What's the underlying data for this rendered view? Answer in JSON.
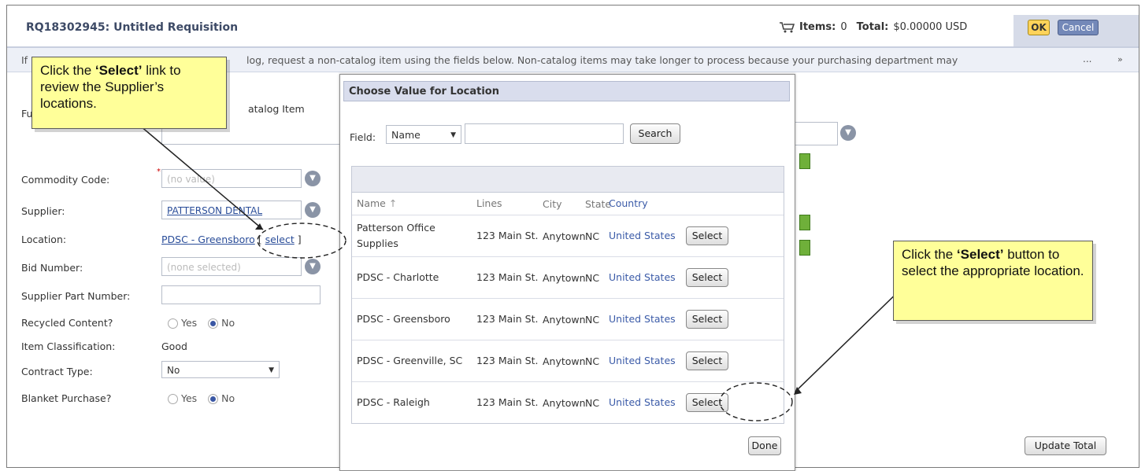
{
  "header": {
    "title": "RQ18302945: Untitled Requisition",
    "items_label": "Items:",
    "items_value": "0",
    "total_label": "Total:",
    "total_value": "$0.00000 USD",
    "ok_label": "OK",
    "cancel_label": "Cancel"
  },
  "info_bar": {
    "lead": "If",
    "text": "log, request a non-catalog item using the fields below. Non-catalog items may take longer to process because your purchasing department may",
    "dots": "...",
    "scroll_icon": "»"
  },
  "form": {
    "partial_label": "Fu",
    "partial_value": "atalog Item",
    "commodity_label": "Commodity Code:",
    "commodity_value": "(no value)",
    "supplier_label": "Supplier:",
    "supplier_value": "PATTERSON DENTAL",
    "location_label": "Location:",
    "location_value": "PDSC - Greensboro",
    "location_select_prefix": "[",
    "location_select": "select",
    "location_select_suffix": "]",
    "bid_label": "Bid Number:",
    "bid_value": "(none selected)",
    "part_label": "Supplier Part Number:",
    "recycled_label": "Recycled Content?",
    "yes": "Yes",
    "no": "No",
    "item_class_label": "Item Classification:",
    "item_class_value": "Good",
    "contract_label": "Contract Type:",
    "contract_value": "No",
    "blanket_label": "Blanket Purchase?",
    "update_total": "Update Total"
  },
  "modal": {
    "title": "Choose Value for Location",
    "field_label": "Field:",
    "field_value": "Name",
    "search_button": "Search",
    "columns": [
      "Name",
      "Lines",
      "City",
      "State",
      "Country"
    ],
    "sort_indicator": "↑",
    "rows": [
      {
        "name": "Patterson Office Supplies",
        "lines": "123 Main St.",
        "city": "Anytown",
        "state": "NC",
        "country": "United States",
        "action": "Select"
      },
      {
        "name": "PDSC - Charlotte",
        "lines": "123 Main St.",
        "city": "Anytown",
        "state": "NC",
        "country": "United States",
        "action": "Select"
      },
      {
        "name": "PDSC - Greensboro",
        "lines": "123 Main St.",
        "city": "Anytown",
        "state": "NC",
        "country": "United States",
        "action": "Select"
      },
      {
        "name": "PDSC - Greenville, SC",
        "lines": "123 Main St.",
        "city": "Anytown",
        "state": "NC",
        "country": "United States",
        "action": "Select"
      },
      {
        "name": "PDSC - Raleigh",
        "lines": "123 Main St.",
        "city": "Anytown",
        "state": "NC",
        "country": "United States",
        "action": "Select"
      }
    ],
    "done_button": "Done"
  },
  "callouts": {
    "left_pre": "Click the ",
    "left_bold": "‘Select’",
    "left_post": " link to review the Supplier’s locations.",
    "right_pre": "Click the ",
    "right_bold": "‘Select’",
    "right_post": " button to select the appropriate location."
  }
}
